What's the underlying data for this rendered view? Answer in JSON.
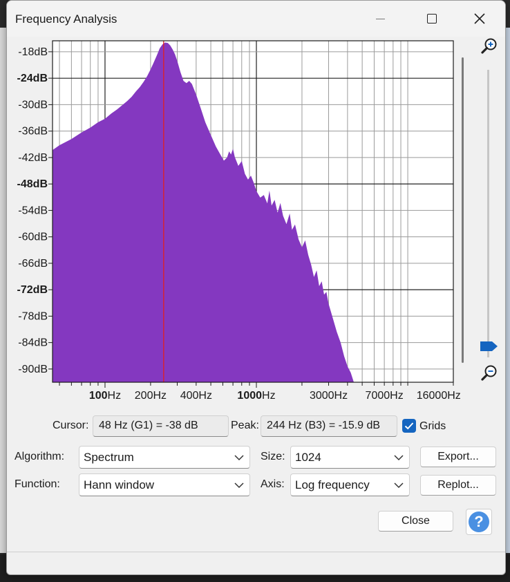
{
  "window": {
    "title": "Frequency Analysis"
  },
  "chart_data": {
    "type": "area",
    "x_scale": "log",
    "xlim": [
      45,
      20000
    ],
    "ylim": [
      -93,
      -15.5
    ],
    "grid": true,
    "y_ticks": [
      "-18dB",
      "-24dB",
      "-30dB",
      "-36dB",
      "-42dB",
      "-48dB",
      "-54dB",
      "-60dB",
      "-66dB",
      "-72dB",
      "-78dB",
      "-84dB",
      "-90dB"
    ],
    "y_tick_values": [
      -18,
      -24,
      -30,
      -36,
      -42,
      -48,
      -54,
      -60,
      -66,
      -72,
      -78,
      -84,
      -90
    ],
    "y_bold": [
      -24,
      -48,
      -72
    ],
    "x_ticks": [
      {
        "value": 100,
        "num": "100",
        "unit": "Hz",
        "bold": true
      },
      {
        "value": 200,
        "num": "200",
        "unit": "Hz",
        "bold": false
      },
      {
        "value": 400,
        "num": "400",
        "unit": "Hz",
        "bold": false
      },
      {
        "value": 1000,
        "num": "1000",
        "unit": "Hz",
        "bold": true
      },
      {
        "value": 3000,
        "num": "3000",
        "unit": "Hz",
        "bold": false
      },
      {
        "value": 7000,
        "num": "7000",
        "unit": "Hz",
        "bold": false
      },
      {
        "value": 16000,
        "num": "16000",
        "unit": "Hz",
        "bold": false
      }
    ],
    "peak_marker_hz": 244,
    "colors": {
      "fill": "#8438c0",
      "marker": "#e02020",
      "grid": "#9a9a9a",
      "bold_grid": "#202020"
    },
    "spectrum": [
      [
        45,
        -40.3
      ],
      [
        50,
        -39.2
      ],
      [
        60,
        -37.8
      ],
      [
        70,
        -36.3
      ],
      [
        80,
        -35.2
      ],
      [
        90,
        -34.0
      ],
      [
        100,
        -33.2
      ],
      [
        110,
        -32.0
      ],
      [
        120,
        -31.1
      ],
      [
        130,
        -30.1
      ],
      [
        140,
        -29.2
      ],
      [
        150,
        -28.2
      ],
      [
        160,
        -27.0
      ],
      [
        170,
        -26.0
      ],
      [
        180,
        -24.8
      ],
      [
        190,
        -23.5
      ],
      [
        200,
        -22.0
      ],
      [
        210,
        -20.4
      ],
      [
        220,
        -18.8
      ],
      [
        230,
        -17.2
      ],
      [
        240,
        -16.3
      ],
      [
        250,
        -15.9
      ],
      [
        260,
        -16.0
      ],
      [
        270,
        -16.6
      ],
      [
        280,
        -17.5
      ],
      [
        290,
        -18.6
      ],
      [
        300,
        -20.1
      ],
      [
        315,
        -22.6
      ],
      [
        330,
        -24.6
      ],
      [
        345,
        -25.1
      ],
      [
        360,
        -24.6
      ],
      [
        375,
        -25.3
      ],
      [
        400,
        -27.7
      ],
      [
        430,
        -30.9
      ],
      [
        460,
        -34.0
      ],
      [
        500,
        -36.9
      ],
      [
        540,
        -39.5
      ],
      [
        580,
        -41.4
      ],
      [
        610,
        -42.7
      ],
      [
        640,
        -42.0
      ],
      [
        660,
        -40.6
      ],
      [
        680,
        -41.3
      ],
      [
        700,
        -40.0
      ],
      [
        720,
        -41.9
      ],
      [
        760,
        -43.9
      ],
      [
        800,
        -42.8
      ],
      [
        840,
        -45.7
      ],
      [
        880,
        -47.0
      ],
      [
        920,
        -46.1
      ],
      [
        960,
        -47.7
      ],
      [
        1000,
        -49.6
      ],
      [
        1060,
        -51.1
      ],
      [
        1120,
        -50.5
      ],
      [
        1180,
        -52.4
      ],
      [
        1220,
        -49.5
      ],
      [
        1260,
        -52.9
      ],
      [
        1320,
        -51.6
      ],
      [
        1380,
        -54.5
      ],
      [
        1440,
        -52.3
      ],
      [
        1500,
        -55.2
      ],
      [
        1580,
        -57.1
      ],
      [
        1660,
        -54.7
      ],
      [
        1720,
        -58.4
      ],
      [
        1800,
        -57.2
      ],
      [
        1900,
        -60.6
      ],
      [
        2000,
        -62.4
      ],
      [
        2100,
        -60.8
      ],
      [
        2200,
        -64.1
      ],
      [
        2300,
        -66.3
      ],
      [
        2400,
        -69.1
      ],
      [
        2500,
        -67.6
      ],
      [
        2600,
        -71.2
      ],
      [
        2700,
        -70.1
      ],
      [
        2800,
        -73.1
      ],
      [
        2900,
        -72.5
      ],
      [
        3000,
        -75.2
      ],
      [
        3200,
        -78.5
      ],
      [
        3400,
        -81.6
      ],
      [
        3600,
        -84.0
      ],
      [
        3800,
        -87.1
      ],
      [
        4000,
        -89.4
      ],
      [
        4200,
        -90.8
      ],
      [
        4400,
        -93.0
      ]
    ]
  },
  "controls": {
    "cursor_label": "Cursor:",
    "cursor_value": "48 Hz (G1) = -38 dB",
    "peak_label": "Peak:",
    "peak_value": "244 Hz (B3) = -15.9 dB",
    "grids_label": "Grids",
    "grids_checked": true,
    "algorithm_label": "Algorithm:",
    "algorithm_value": "Spectrum",
    "size_label": "Size:",
    "size_value": "1024",
    "function_label": "Function:",
    "function_value": "Hann window",
    "axis_label": "Axis:",
    "axis_value": "Log frequency",
    "export_label": "Export...",
    "replot_label": "Replot...",
    "close_label": "Close",
    "help_label": "?"
  }
}
